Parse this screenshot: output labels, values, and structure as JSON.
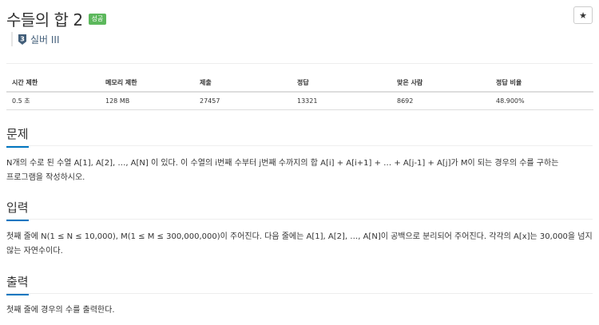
{
  "header": {
    "title": "수들의 합 2",
    "status_badge": "성공",
    "star_icon": "★",
    "tier_label": "실버 III",
    "tier_number": "3"
  },
  "info_table": {
    "headers": [
      "시간 제한",
      "메모리 제한",
      "제출",
      "정답",
      "맞은 사람",
      "정답 비율"
    ],
    "values": [
      "0.5 초",
      "128 MB",
      "27457",
      "13321",
      "8692",
      "48.900%"
    ]
  },
  "sections": {
    "problem": {
      "title": "문제",
      "text": "N개의 수로 된 수열 A[1], A[2], …, A[N] 이 있다. 이 수열의 i번째 수부터 j번째 수까지의 합 A[i] + A[i+1] + … + A[j-1] + A[j]가 M이 되는 경우의 수를 구하는 프로그램을 작성하시오."
    },
    "input": {
      "title": "입력",
      "text": "첫째 줄에 N(1 ≤ N ≤ 10,000), M(1 ≤ M ≤ 300,000,000)이 주어진다. 다음 줄에는 A[1], A[2], …, A[N]이 공백으로 분리되어 주어진다. 각각의 A[x]는 30,000을 넘지 않는 자연수이다."
    },
    "output": {
      "title": "출력",
      "text": "첫째 줄에 경우의 수를 출력한다."
    }
  },
  "colors": {
    "success_badge": "#5cb85c",
    "section_underline": "#0076c0",
    "tier_silver": "#435f7a"
  }
}
